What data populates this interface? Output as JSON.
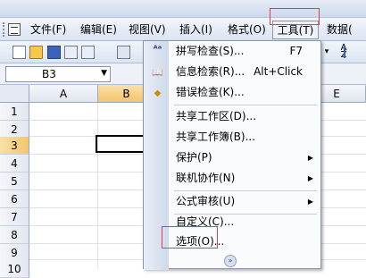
{
  "menubar": {
    "file": "文件(F)",
    "edit": "编辑(E)",
    "view": "视图(V)",
    "insert": "插入(I)",
    "format": "格式(O)",
    "tools": "工具(T)",
    "data": "数据("
  },
  "formula_bar": {
    "name_box": "B3",
    "dropdown_arrow": "▼"
  },
  "sheet": {
    "columns": [
      "A",
      "B",
      "E"
    ],
    "rows": [
      "1",
      "2",
      "3",
      "4",
      "5",
      "6",
      "7",
      "8",
      "9",
      "10"
    ],
    "selected_cell": "B3"
  },
  "tools_menu": {
    "items": [
      {
        "label": "拼写检查(S)...",
        "shortcut": "F7"
      },
      {
        "label": "信息检索(R)...",
        "shortcut": "Alt+Click"
      },
      {
        "label": "错误检查(K)..."
      },
      {
        "label": "共享工作区(D)..."
      },
      {
        "label": "共享工作簿(B)..."
      },
      {
        "label": "保护(P)",
        "submenu": true
      },
      {
        "label": "联机协作(N)",
        "submenu": true
      },
      {
        "label": "公式审核(U)",
        "submenu": true
      },
      {
        "label": "自定义(C)..."
      },
      {
        "label": "选项(O)..."
      }
    ],
    "submenu_arrow": "▶",
    "more_glyph": "»"
  },
  "colors": {
    "highlight_box": "#e03c54",
    "selected_header": "#f3c56d"
  }
}
